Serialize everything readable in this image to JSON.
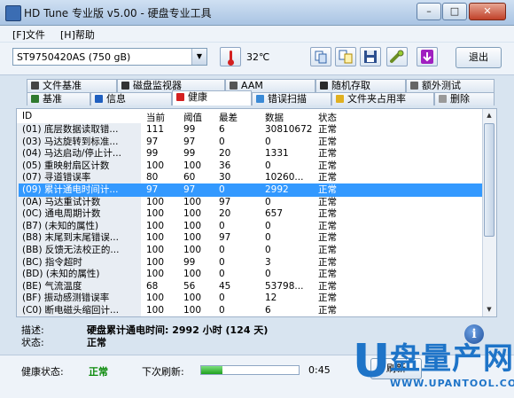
{
  "window": {
    "title": "HD Tune 专业版 v5.00 - 硬盘专业工具",
    "minimize": "–",
    "maximize": "□",
    "close": "✕"
  },
  "menu": [
    {
      "label": "[F]文件"
    },
    {
      "label": "[H]帮助"
    }
  ],
  "toolbar": {
    "drive": "ST9750420AS (750 gB)",
    "temperature": "32℃",
    "exit_label": "退出"
  },
  "tabs_top": [
    {
      "label": "文件基准"
    },
    {
      "label": "磁盘监视器"
    },
    {
      "label": "AAM"
    },
    {
      "label": "随机存取"
    },
    {
      "label": "额外测试"
    }
  ],
  "tabs_bottom": [
    {
      "label": "基准"
    },
    {
      "label": "信息"
    },
    {
      "label": "健康",
      "active": true
    },
    {
      "label": "错误扫描"
    },
    {
      "label": "文件夹占用率"
    },
    {
      "label": "删除"
    }
  ],
  "table": {
    "headers": [
      "ID",
      "当前",
      "阈值",
      "最差",
      "数据",
      "状态"
    ],
    "rows": [
      {
        "id": "(01) 底层数据读取错...",
        "current": "111",
        "threshold": "99",
        "worst": "6",
        "data": "30810672",
        "status": "正常"
      },
      {
        "id": "(03) 马达旋转到标准...",
        "current": "97",
        "threshold": "97",
        "worst": "0",
        "data": "0",
        "status": "正常"
      },
      {
        "id": "(04) 马达启动/停止计...",
        "current": "99",
        "threshold": "99",
        "worst": "20",
        "data": "1331",
        "status": "正常"
      },
      {
        "id": "(05) 重映射扇区计数",
        "current": "100",
        "threshold": "100",
        "worst": "36",
        "data": "0",
        "status": "正常"
      },
      {
        "id": "(07) 寻道错误率",
        "current": "80",
        "threshold": "60",
        "worst": "30",
        "data": "10260...",
        "status": "正常"
      },
      {
        "id": "(09) 累计通电时间计...",
        "current": "97",
        "threshold": "97",
        "worst": "0",
        "data": "2992",
        "status": "正常",
        "selected": true
      },
      {
        "id": "(0A) 马达重试计数",
        "current": "100",
        "threshold": "100",
        "worst": "97",
        "data": "0",
        "status": "正常"
      },
      {
        "id": "(0C) 通电周期计数",
        "current": "100",
        "threshold": "100",
        "worst": "20",
        "data": "657",
        "status": "正常"
      },
      {
        "id": "(B7) (未知的属性)",
        "current": "100",
        "threshold": "100",
        "worst": "0",
        "data": "0",
        "status": "正常"
      },
      {
        "id": "(B8) 末尾到末尾错误...",
        "current": "100",
        "threshold": "100",
        "worst": "97",
        "data": "0",
        "status": "正常"
      },
      {
        "id": "(BB) 反馈无法校正的...",
        "current": "100",
        "threshold": "100",
        "worst": "0",
        "data": "0",
        "status": "正常"
      },
      {
        "id": "(BC) 指令超时",
        "current": "100",
        "threshold": "99",
        "worst": "0",
        "data": "3",
        "status": "正常"
      },
      {
        "id": "(BD) (未知的属性)",
        "current": "100",
        "threshold": "100",
        "worst": "0",
        "data": "0",
        "status": "正常"
      },
      {
        "id": "(BE) 气流温度",
        "current": "68",
        "threshold": "56",
        "worst": "45",
        "data": "53798...",
        "status": "正常"
      },
      {
        "id": "(BF) 振动感测错误率",
        "current": "100",
        "threshold": "100",
        "worst": "0",
        "data": "12",
        "status": "正常"
      },
      {
        "id": "(C0) 断电磁头缩回计...",
        "current": "100",
        "threshold": "100",
        "worst": "0",
        "data": "6",
        "status": "正常"
      }
    ]
  },
  "description": {
    "label": "描述:",
    "value": "硬盘累计通电时间: 2992 小时 (124 天)"
  },
  "status": {
    "label": "状态:",
    "value": "正常"
  },
  "statusbar": {
    "health_label": "健康状态:",
    "health_value": "正常",
    "next_refresh_label": "下次刷新:",
    "refresh_progress": 0.22,
    "countdown": "0:45",
    "refresh_button": "刷新"
  },
  "watermark": {
    "letter": "U",
    "brand": "盘量产网",
    "url": "WWW.UPANTOOL.COM"
  },
  "colors": {
    "selection": "#3399ff",
    "health_ok": "#0a8a0a",
    "watermark": "#1e74c8"
  }
}
